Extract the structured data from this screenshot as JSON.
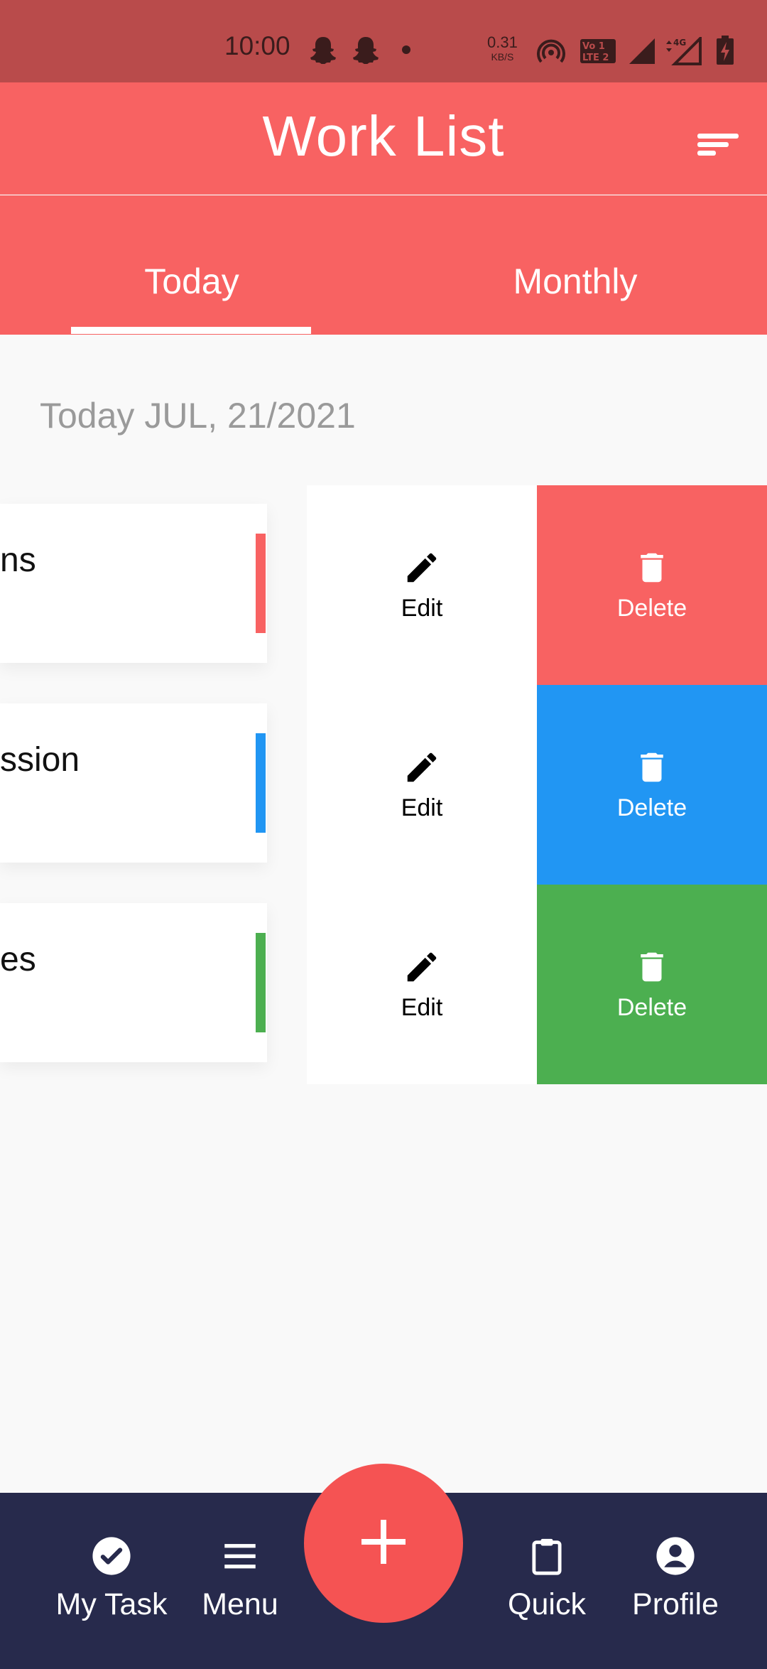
{
  "status_bar": {
    "time": "10:00",
    "speed_value": "0.31",
    "speed_unit": "KB/S",
    "icons": [
      "snapchat-icon",
      "snapchat-icon",
      "dot-icon",
      "hotspot-icon",
      "volte-icon",
      "signal-icon",
      "signal-4g-icon",
      "battery-charging-icon"
    ]
  },
  "header": {
    "title": "Work List",
    "filter_icon": "sort-filter-icon"
  },
  "tabs": [
    {
      "label": "Today",
      "selected": true
    },
    {
      "label": "Monthly",
      "selected": false
    }
  ],
  "date_label": "Today JUL, 21/2021",
  "tasks": [
    {
      "title": "ns",
      "color": "#f86262"
    },
    {
      "title": "ssion",
      "color": "#2196f3"
    },
    {
      "title": "es",
      "color": "#4caf50"
    }
  ],
  "actions": [
    {
      "edit_label": "Edit",
      "delete_label": "Delete",
      "delete_color": "#f86262"
    },
    {
      "edit_label": "Edit",
      "delete_label": "Delete",
      "delete_color": "#2196f3"
    },
    {
      "edit_label": "Edit",
      "delete_label": "Delete",
      "delete_color": "#4caf50"
    }
  ],
  "bottom_nav": {
    "items": [
      {
        "label": "My Task",
        "icon": "check-circle-icon"
      },
      {
        "label": "Menu",
        "icon": "menu-icon"
      },
      {
        "label": "Quick",
        "icon": "clipboard-icon"
      },
      {
        "label": "Profile",
        "icon": "profile-icon"
      }
    ],
    "fab_icon": "plus-icon"
  },
  "colors": {
    "status_bar": "#b94b4b",
    "header": "#f86262",
    "nav": "#272a4c",
    "fab": "#f55353"
  }
}
